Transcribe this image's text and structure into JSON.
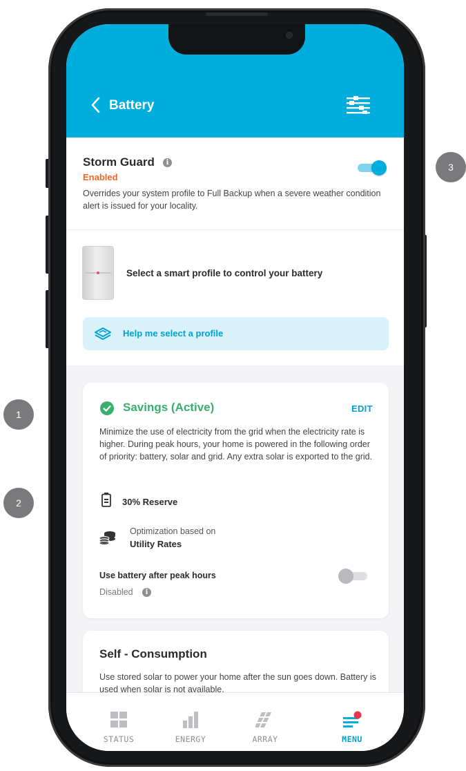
{
  "header": {
    "title": "Battery"
  },
  "storm_guard": {
    "title": "Storm Guard",
    "status": "Enabled",
    "description": "Overrides your system profile to Full Backup when a severe weather condition alert is issued for your locality.",
    "toggle_on": true
  },
  "profile": {
    "prompt": "Select a smart profile to control your battery",
    "help_label": "Help me select a profile"
  },
  "savings": {
    "title": "Savings (Active)",
    "edit_label": "EDIT",
    "description": "Minimize the use of electricity from the grid when the electricity rate is higher. During peak hours, your home is powered in the following order of priority: battery, solar and grid. Any extra solar is exported to the grid.",
    "reserve": "30% Reserve",
    "optimization_label": "Optimization based on",
    "optimization_value": "Utility Rates",
    "peak_label": "Use battery after peak hours",
    "peak_status": "Disabled",
    "peak_toggle_on": false
  },
  "self_consumption": {
    "title": "Self - Consumption",
    "description": "Use stored solar to power your home after the sun goes down. Battery is used when solar is not available."
  },
  "nav": [
    {
      "label": "STATUS",
      "icon": "status-grid-icon",
      "active": false
    },
    {
      "label": "ENERGY",
      "icon": "energy-bars-icon",
      "active": false
    },
    {
      "label": "ARRAY",
      "icon": "solar-array-icon",
      "active": false
    },
    {
      "label": "MENU",
      "icon": "menu-lines-icon",
      "active": true
    }
  ],
  "callouts": [
    "1",
    "2",
    "3"
  ],
  "colors": {
    "accent": "#00aedd",
    "success": "#3aaf6b",
    "warning": "#f26522",
    "notification": "#e8344a"
  }
}
